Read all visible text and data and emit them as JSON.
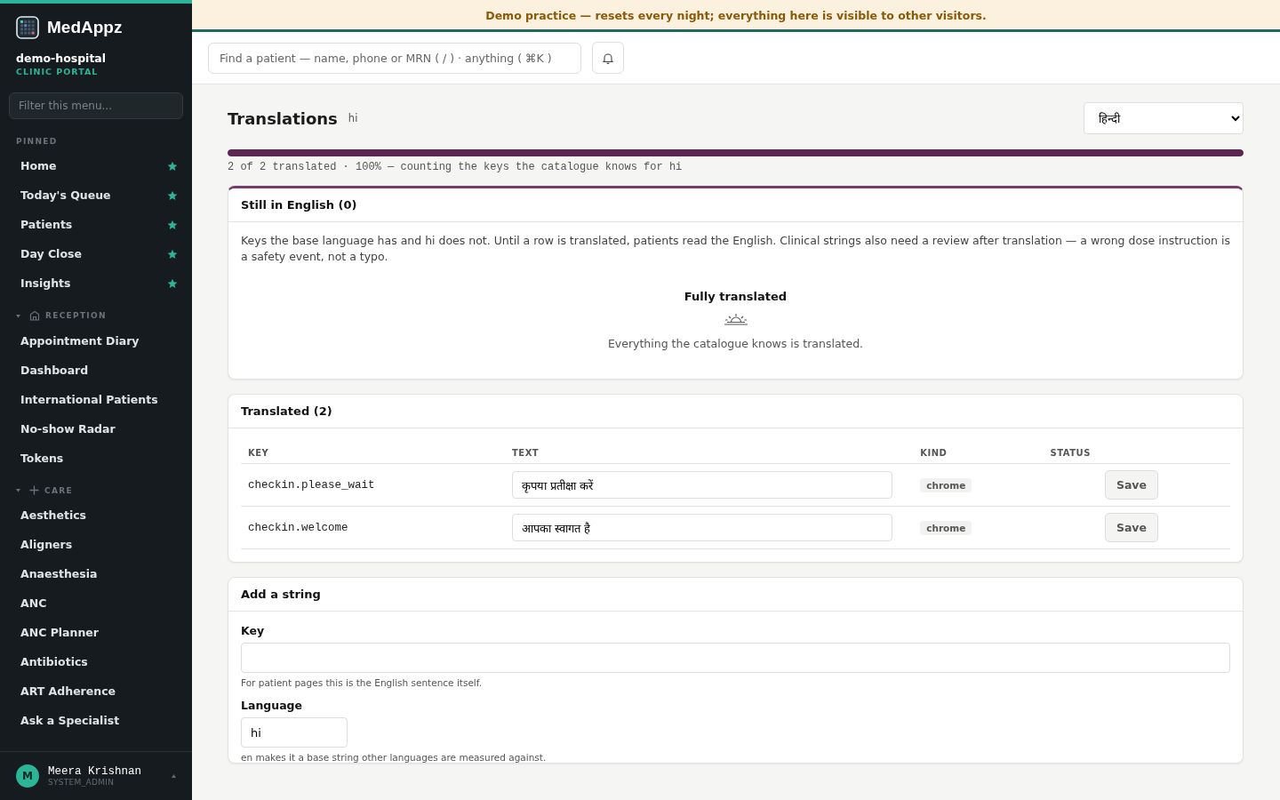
{
  "sidebar": {
    "brand": "MedAppz",
    "tenant": "demo-hospital",
    "portal": "CLINIC PORTAL",
    "filter": {
      "placeholder": "Filter this menu..."
    },
    "groups": [
      {
        "title": "PINNED",
        "kind": "pinned",
        "items": [
          {
            "label": "Home",
            "pinned": true
          },
          {
            "label": "Today's Queue",
            "pinned": true
          },
          {
            "label": "Patients",
            "pinned": true
          },
          {
            "label": "Day Close",
            "pinned": true
          },
          {
            "label": "Insights",
            "pinned": true
          }
        ]
      },
      {
        "title": "RECEPTION",
        "kind": "reception",
        "expanded": true,
        "items": [
          {
            "label": "Appointment Diary",
            "pinned": false
          },
          {
            "label": "Dashboard",
            "pinned": false
          },
          {
            "label": "International Patients",
            "pinned": false
          },
          {
            "label": "No-show Radar",
            "pinned": false
          },
          {
            "label": "Tokens",
            "pinned": false
          }
        ]
      },
      {
        "title": "CARE",
        "kind": "care",
        "expanded": true,
        "items": [
          {
            "label": "Aesthetics",
            "pinned": false
          },
          {
            "label": "Aligners",
            "pinned": false
          },
          {
            "label": "Anaesthesia",
            "pinned": false
          },
          {
            "label": "ANC",
            "pinned": false
          },
          {
            "label": "ANC Planner",
            "pinned": false
          },
          {
            "label": "Antibiotics",
            "pinned": false
          },
          {
            "label": "ART Adherence",
            "pinned": false
          },
          {
            "label": "Ask a Specialist",
            "pinned": false
          }
        ]
      }
    ],
    "user": {
      "initial": "M",
      "name": "Meera Krishnan",
      "role": "SYSTEM_ADMIN"
    }
  },
  "banner": "Demo practice — resets every night; everything here is visible to other visitors.",
  "search": {
    "placeholder": "Find a patient — name, phone or MRN ( / ) · anything ( ⌘K )"
  },
  "page": {
    "title": "Translations",
    "code": "hi",
    "language_select": "हिन्दी",
    "progress": {
      "level": 1.0,
      "caption": "2 of 2 translated · 100% — counting the keys the catalogue knows for hi"
    }
  },
  "untranslated": {
    "title": "Still in English (0)",
    "description": "Keys the base language has and hi does not. Until a row is translated, patients read the English. Clinical strings also need a review after translation — a wrong dose instruction is a safety event, not a typo.",
    "empty_title": "Fully translated",
    "empty_text": "Everything the catalogue knows is translated."
  },
  "translated": {
    "title": "Translated (2)",
    "columns": [
      "KEY",
      "TEXT",
      "KIND",
      "STATUS"
    ],
    "rows": [
      {
        "key": "checkin.please_wait",
        "text": "कृपया प्रतीक्षा करें",
        "kind": "chrome",
        "action": "Save"
      },
      {
        "key": "checkin.welcome",
        "text": "आपका स्वागत है",
        "kind": "chrome",
        "action": "Save"
      }
    ]
  },
  "add": {
    "title": "Add a string",
    "fields": [
      {
        "label": "Key",
        "hint": "For patient pages this is the English sentence itself.",
        "kind": "wide"
      },
      {
        "label": "Language",
        "value": "hi",
        "hint": "en makes it a base string other languages are measured against.",
        "kind": "short"
      }
    ]
  }
}
